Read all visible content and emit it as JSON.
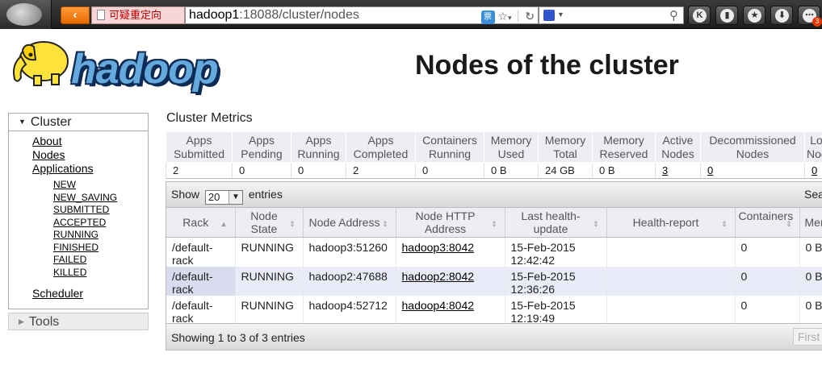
{
  "browser": {
    "back_symbol": "‹",
    "redirect_label": "可疑重定向",
    "url_host": "hadoop1",
    "url_rest": ":18088/cluster/nodes",
    "url_badge": "票",
    "toolbar_buttons": [
      "K",
      "lock",
      "star",
      "download",
      "menu"
    ],
    "menu_count": "3"
  },
  "header": {
    "logo_text": "hadoop",
    "title": "Nodes of the cluster"
  },
  "nav": {
    "cluster_label": "Cluster",
    "links": [
      "About",
      "Nodes",
      "Applications"
    ],
    "app_states": [
      "NEW",
      "NEW_SAVING",
      "SUBMITTED",
      "ACCEPTED",
      "RUNNING",
      "FINISHED",
      "FAILED",
      "KILLED"
    ],
    "scheduler_label": "Scheduler",
    "tools_label": "Tools"
  },
  "metrics": {
    "caption": "Cluster Metrics",
    "headers": [
      "Apps Submitted",
      "Apps Pending",
      "Apps Running",
      "Apps Completed",
      "Containers Running",
      "Memory Used",
      "Memory Total",
      "Memory Reserved",
      "Active Nodes",
      "Decommissioned Nodes",
      "Lo Nod"
    ],
    "values": [
      "2",
      "0",
      "0",
      "2",
      "0",
      "0 B",
      "24 GB",
      "0 B",
      "3",
      "0",
      "0"
    ]
  },
  "nodes_table": {
    "show_label": "Show",
    "page_size": "20",
    "entries_label": "entries",
    "search_label": "Sea",
    "headers": [
      "Rack",
      "Node State",
      "Node Address",
      "Node HTTP Address",
      "Last health-update",
      "Health-report",
      "Containers",
      "Mem U"
    ],
    "rows": [
      {
        "rack": "/default-rack",
        "state": "RUNNING",
        "address": "hadoop3:51260",
        "http": "hadoop3:8042",
        "health_update": "15-Feb-2015 12:42:42",
        "health_report": "",
        "containers": "0",
        "mem": "0 B"
      },
      {
        "rack": "/default-rack",
        "state": "RUNNING",
        "address": "hadoop2:47688",
        "http": "hadoop2:8042",
        "health_update": "15-Feb-2015 12:36:26",
        "health_report": "",
        "containers": "0",
        "mem": "0 B"
      },
      {
        "rack": "/default-rack",
        "state": "RUNNING",
        "address": "hadoop4:52712",
        "http": "hadoop4:8042",
        "health_update": "15-Feb-2015 12:19:49",
        "health_report": "",
        "containers": "0",
        "mem": "0 B"
      }
    ],
    "info": "Showing 1 to 3 of 3 entries",
    "first_label": "First"
  }
}
